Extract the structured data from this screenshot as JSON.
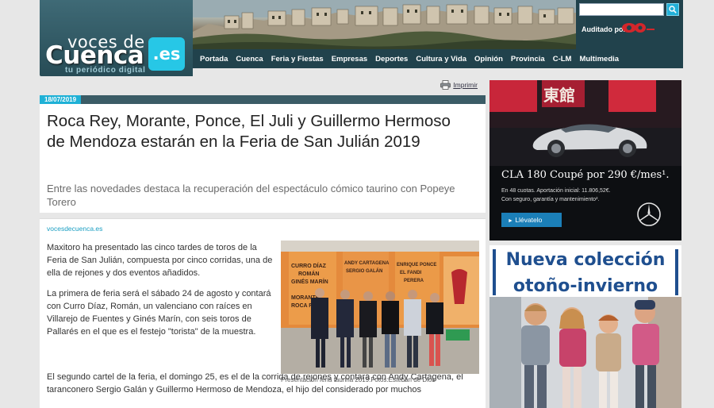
{
  "site": {
    "logo_top": "voces de",
    "logo_main": "Cuenca",
    "logo_tld": ".es",
    "tagline": "tu periódico digital"
  },
  "header": {
    "search_placeholder": "",
    "audit_label": "Auditado por:"
  },
  "nav": {
    "items": [
      "Portada",
      "Cuenca",
      "Feria y Fiestas",
      "Empresas",
      "Deportes",
      "Cultura y Vida",
      "Opinión",
      "Provincia",
      "C-LM",
      "Multimedia"
    ]
  },
  "article": {
    "print_label": "Imprimir",
    "date": "18/07/2019",
    "headline": "Roca Rey, Morante, Ponce, El Juli y Guillermo Hermoso de Mendoza estarán en la Feria de San Julián 2019",
    "subheadline": "Entre las novedades destaca la recuperación del espectáculo cómico taurino con Popeye Torero",
    "source": "vocesdecuenca.es",
    "paragraphs": [
      "Maxitoro ha presentado las cinco tardes de toros de la Feria de San Julián, compuesta por cinco corridas, una de ella de rejones y dos eventos añadidos.",
      "La primera de feria será el sábado 24 de agosto y contará con Curro Díaz, Román, un valenciano con raíces en Villarejo de Fuentes y Ginés Marín, con seis toros de Pallarés en el que es el festejo \"torista\" de la muestra."
    ],
    "wide_paragraph": "El segundo cartel de la feria, el domingo 25, es el de la corrida de rejones y contará con Andy Cartagena, el taranconero Sergio Galán y Guillermo Hermoso de Mendoza, el hijo del considerado por muchos",
    "photo_caption": "Presentación feria taurina 2019.Fotos:Esteban de Dios",
    "photo_poster_text": [
      "CURRO DÍAZ",
      "ROMÁN",
      "GINÉS MARÍN",
      "ANDY CARTAGENA",
      "SERGIO GALÁN",
      "ENRIQUE PONCE",
      "EL FANDI",
      "PERERA",
      "MORANTE",
      "ROCA REY"
    ]
  },
  "ads": {
    "mercedes": {
      "headline": "CLA 180 Coupé por 290 €/mes¹.",
      "line1": "En 48 cuotas. Aportación inicial: 11.806,52€.",
      "line2": "Con seguro, garantía y mantenimiento².",
      "cta": "Llévatelo",
      "sign_text": "東館"
    },
    "kids": {
      "title_line1": "Nueva colección",
      "title_line2": "otoño-invierno"
    }
  },
  "colors": {
    "header_bg": "#21424c",
    "accent": "#1fb1d6",
    "kids_title": "#1f4f8f"
  }
}
